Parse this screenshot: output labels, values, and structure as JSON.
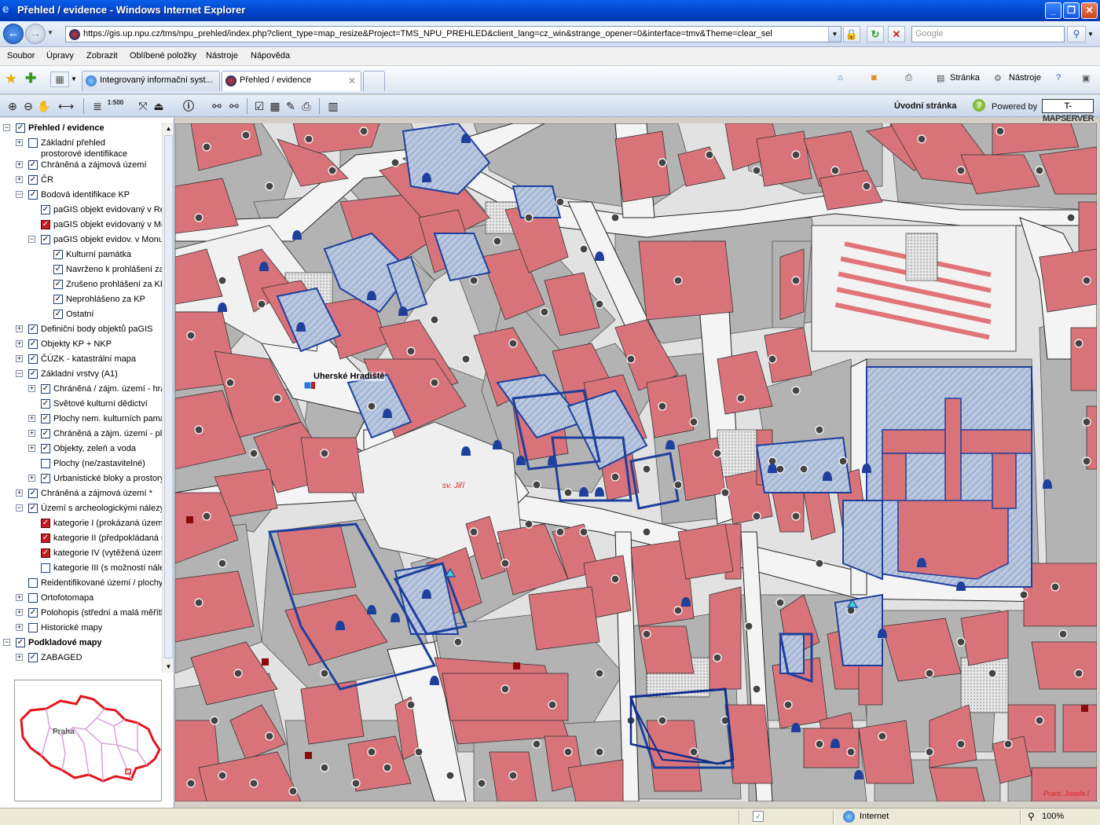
{
  "window": {
    "title": "Přehled / evidence - Windows Internet Explorer",
    "minimize": "_",
    "maximize": "❐",
    "close": "✕"
  },
  "address": {
    "url": "https://gis.up.npu.cz/tms/npu_prehled/index.php?client_type=map_resize&Project=TMS_NPU_PREHLED&client_lang=cz_win&strange_opener=0&interface=tmv&Theme=clear_sel",
    "search_placeholder": "Google"
  },
  "menu": [
    "Soubor",
    "Úpravy",
    "Zobrazit",
    "Oblíbené položky",
    "Nástroje",
    "Nápověda"
  ],
  "tabs": [
    {
      "label": "Integrovaný informační syst..."
    },
    {
      "label": "Přehled / evidence"
    }
  ],
  "commandbar": {
    "page": "Stránka",
    "tools": "Nástroje"
  },
  "apptoolbar": {
    "scale_label": "1:500",
    "home_link": "Úvodní stránka",
    "powered_by": "Powered by",
    "logo": "T-MAPSERVER"
  },
  "layers": [
    {
      "label": "Přehled / evidence",
      "level": 0,
      "checked": true,
      "bold": true,
      "expand": "-"
    },
    {
      "label": "Základní přehled",
      "level": 1,
      "checked": false,
      "expand": "+"
    },
    {
      "label": "prostorové identifikace",
      "level": 1,
      "checked": null,
      "expand": null,
      "continuation": true
    },
    {
      "label": "Chráněná a zájmová území",
      "level": 1,
      "checked": true,
      "expand": "+"
    },
    {
      "label": "ČR",
      "level": 1,
      "checked": true,
      "expand": "+"
    },
    {
      "label": "Bodová identifikace KP",
      "level": 1,
      "checked": true,
      "expand": "-"
    },
    {
      "label": "paGIS objekt evidovaný v Re",
      "level": 2,
      "checked": true,
      "expand": null
    },
    {
      "label": "paGIS objekt evidovaný v Mo",
      "level": 2,
      "checked": true,
      "expand": null,
      "red": true
    },
    {
      "label": "paGIS objekt evidov. v Monum",
      "level": 2,
      "checked": true,
      "expand": "-"
    },
    {
      "label": "Kulturní památka",
      "level": 3,
      "checked": true,
      "expand": null
    },
    {
      "label": "Navrženo k prohlášení za",
      "level": 3,
      "checked": true,
      "expand": null
    },
    {
      "label": "Zrušeno prohlášení za KP",
      "level": 3,
      "checked": true,
      "expand": null
    },
    {
      "label": "Neprohlášeno za KP",
      "level": 3,
      "checked": true,
      "expand": null
    },
    {
      "label": "Ostatní",
      "level": 3,
      "checked": true,
      "expand": null
    },
    {
      "label": "Definiční body objektů paGIS",
      "level": 1,
      "checked": true,
      "expand": "+"
    },
    {
      "label": "Objekty KP + NKP",
      "level": 1,
      "checked": true,
      "expand": "+"
    },
    {
      "label": "ČÚZK - katastrální mapa",
      "level": 1,
      "checked": true,
      "expand": "+"
    },
    {
      "label": "Základní vrstvy (A1)",
      "level": 1,
      "checked": true,
      "expand": "-"
    },
    {
      "label": "Chráněná / zájm. území - hra",
      "level": 2,
      "checked": true,
      "expand": "+"
    },
    {
      "label": "Světové kulturní dědictví",
      "level": 2,
      "checked": true,
      "expand": null
    },
    {
      "label": "Plochy nem. kulturních památ",
      "level": 2,
      "checked": true,
      "expand": "+"
    },
    {
      "label": "Chráněná a zájm. území - plo",
      "level": 2,
      "checked": true,
      "expand": "+"
    },
    {
      "label": "Objekty, zeleň a voda",
      "level": 2,
      "checked": true,
      "expand": "+"
    },
    {
      "label": "Plochy (ne/zastavitelné)",
      "level": 2,
      "checked": false,
      "expand": null
    },
    {
      "label": "Urbanistické bloky a prostory",
      "level": 2,
      "checked": true,
      "expand": "+"
    },
    {
      "label": "Chráněná a zájmová území *",
      "level": 1,
      "checked": true,
      "expand": "+"
    },
    {
      "label": "Území s archeologickými nálezy",
      "level": 1,
      "checked": true,
      "expand": "-"
    },
    {
      "label": "kategorie I (prokázaná území",
      "level": 2,
      "checked": true,
      "expand": null,
      "red": true
    },
    {
      "label": "kategorie II (předpokládaná ú",
      "level": 2,
      "checked": true,
      "expand": null,
      "red": true
    },
    {
      "label": "kategorie IV (vytěžená územ",
      "level": 2,
      "checked": true,
      "expand": null,
      "red": true
    },
    {
      "label": "kategorie III (s možností nález",
      "level": 2,
      "checked": false,
      "expand": null
    },
    {
      "label": "Reidentifikované území / plochy",
      "level": 1,
      "checked": false,
      "expand": null
    },
    {
      "label": "Ortofotomapa",
      "level": 1,
      "checked": false,
      "expand": "+"
    },
    {
      "label": "Polohopis (střední a malá měřítka",
      "level": 1,
      "checked": true,
      "expand": "+"
    },
    {
      "label": "Historické mapy",
      "level": 1,
      "checked": false,
      "expand": "+"
    },
    {
      "label": "Podkladové mapy",
      "level": 0,
      "checked": true,
      "bold": true,
      "expand": "-"
    },
    {
      "label": "ZABAGED",
      "level": 1,
      "checked": true,
      "expand": "+"
    }
  ],
  "overview": {
    "label": "Praha"
  },
  "map": {
    "city_label": "Uherské Hradiště",
    "church_label": "sv. Jiří",
    "street_label": "Prant. Josefa I"
  },
  "status": {
    "zone": "Internet",
    "zoom": "100%"
  },
  "colors": {
    "building": "#d9737a",
    "monument_outline": "#1e3f9c",
    "road": "#f2f2f2",
    "block": "#b4b4b4"
  }
}
